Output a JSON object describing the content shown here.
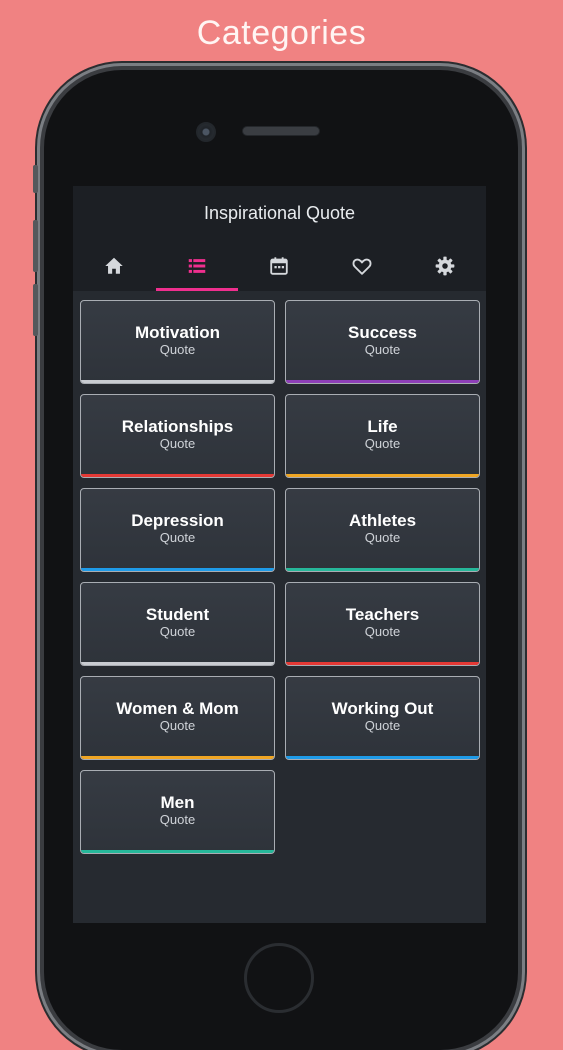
{
  "headline": "Categories",
  "app": {
    "title": "Inspirational Quote",
    "tabs": [
      {
        "icon": "home-icon",
        "active": false
      },
      {
        "icon": "list-icon",
        "active": true
      },
      {
        "icon": "calendar-icon",
        "active": false
      },
      {
        "icon": "heart-icon",
        "active": false
      },
      {
        "icon": "gear-icon",
        "active": false
      }
    ],
    "accent": "#ef2f8e",
    "categories": [
      {
        "name": "Motivation",
        "sub": "Quote",
        "color": "#c9ccd1"
      },
      {
        "name": "Success",
        "sub": "Quote",
        "color": "#8e3fb8"
      },
      {
        "name": "Relationships",
        "sub": "Quote",
        "color": "#e53935"
      },
      {
        "name": "Life",
        "sub": "Quote",
        "color": "#f0a623"
      },
      {
        "name": "Depression",
        "sub": "Quote",
        "color": "#1e9be8"
      },
      {
        "name": "Athletes",
        "sub": "Quote",
        "color": "#26b89a"
      },
      {
        "name": "Student",
        "sub": "Quote",
        "color": "#c9ccd1"
      },
      {
        "name": "Teachers",
        "sub": "Quote",
        "color": "#e53935"
      },
      {
        "name": "Women & Mom",
        "sub": "Quote",
        "color": "#f0a623"
      },
      {
        "name": "Working Out",
        "sub": "Quote",
        "color": "#1e9be8"
      },
      {
        "name": "Men",
        "sub": "Quote",
        "color": "#26b89a"
      }
    ]
  }
}
